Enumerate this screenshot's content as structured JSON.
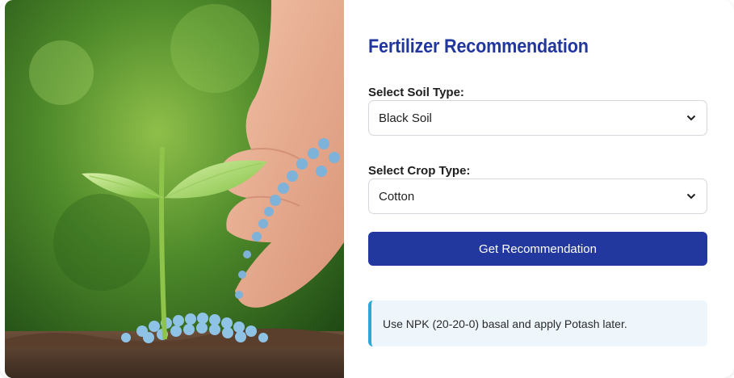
{
  "hero": {
    "icon": "seedling-fertilizer-photo"
  },
  "form": {
    "title": "Fertilizer Recommendation",
    "soil": {
      "label": "Select Soil Type:",
      "value": "Black Soil"
    },
    "crop": {
      "label": "Select Crop Type:",
      "value": "Cotton"
    },
    "submit_label": "Get Recommendation",
    "result_text": "Use NPK (20-20-0) basal and apply Potash later."
  },
  "colors": {
    "title": "#22379e",
    "button": "#22389e",
    "result_bg": "#eef5fb",
    "result_accent": "#2fa6d8"
  }
}
